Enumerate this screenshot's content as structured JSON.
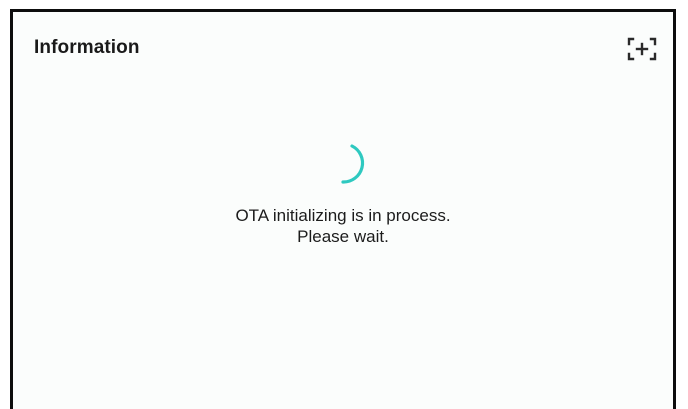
{
  "dialog": {
    "title": "Information",
    "expand_icon": "expand-bracket-plus-icon",
    "spinner_icon": "loading-spinner-icon",
    "spinner_color": "#2ec9c0",
    "message_line1": "OTA initializing is in process.",
    "message_line2": "Please wait."
  }
}
